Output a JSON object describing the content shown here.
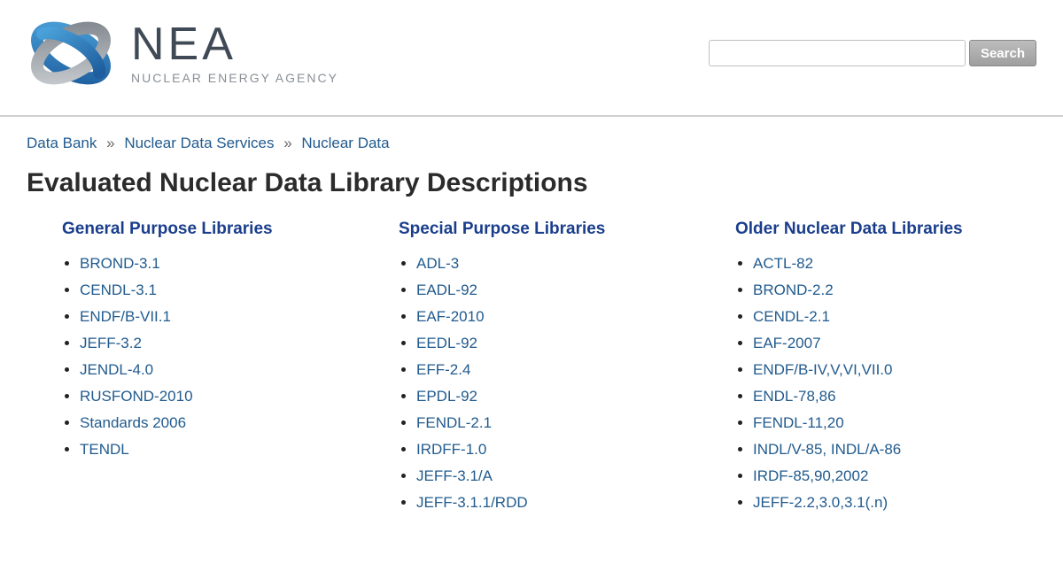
{
  "logo": {
    "title": "NEA",
    "subtitle": "NUCLEAR ENERGY AGENCY"
  },
  "search": {
    "button": "Search"
  },
  "breadcrumb": {
    "items": [
      "Data Bank",
      "Nuclear Data Services",
      "Nuclear Data"
    ]
  },
  "page_title": "Evaluated Nuclear Data Library Descriptions",
  "columns": [
    {
      "title": "General Purpose Libraries",
      "items": [
        "BROND-3.1",
        "CENDL-3.1",
        "ENDF/B-VII.1",
        "JEFF-3.2",
        "JENDL-4.0",
        "RUSFOND-2010",
        "Standards 2006",
        "TENDL"
      ]
    },
    {
      "title": "Special Purpose Libraries",
      "items": [
        "ADL-3",
        "EADL-92",
        "EAF-2010",
        "EEDL-92",
        "EFF-2.4",
        "EPDL-92",
        "FENDL-2.1",
        "IRDFF-1.0",
        "JEFF-3.1/A",
        "JEFF-3.1.1/RDD"
      ]
    },
    {
      "title": "Older Nuclear Data Libraries",
      "items": [
        "ACTL-82",
        "BROND-2.2",
        "CENDL-2.1",
        "EAF-2007",
        "ENDF/B-IV,V,VI,VII.0",
        "ENDL-78,86",
        "FENDL-11,20",
        "INDL/V-85, INDL/A-86",
        "IRDF-85,90,2002",
        "JEFF-2.2,3.0,3.1(.n)"
      ]
    }
  ]
}
